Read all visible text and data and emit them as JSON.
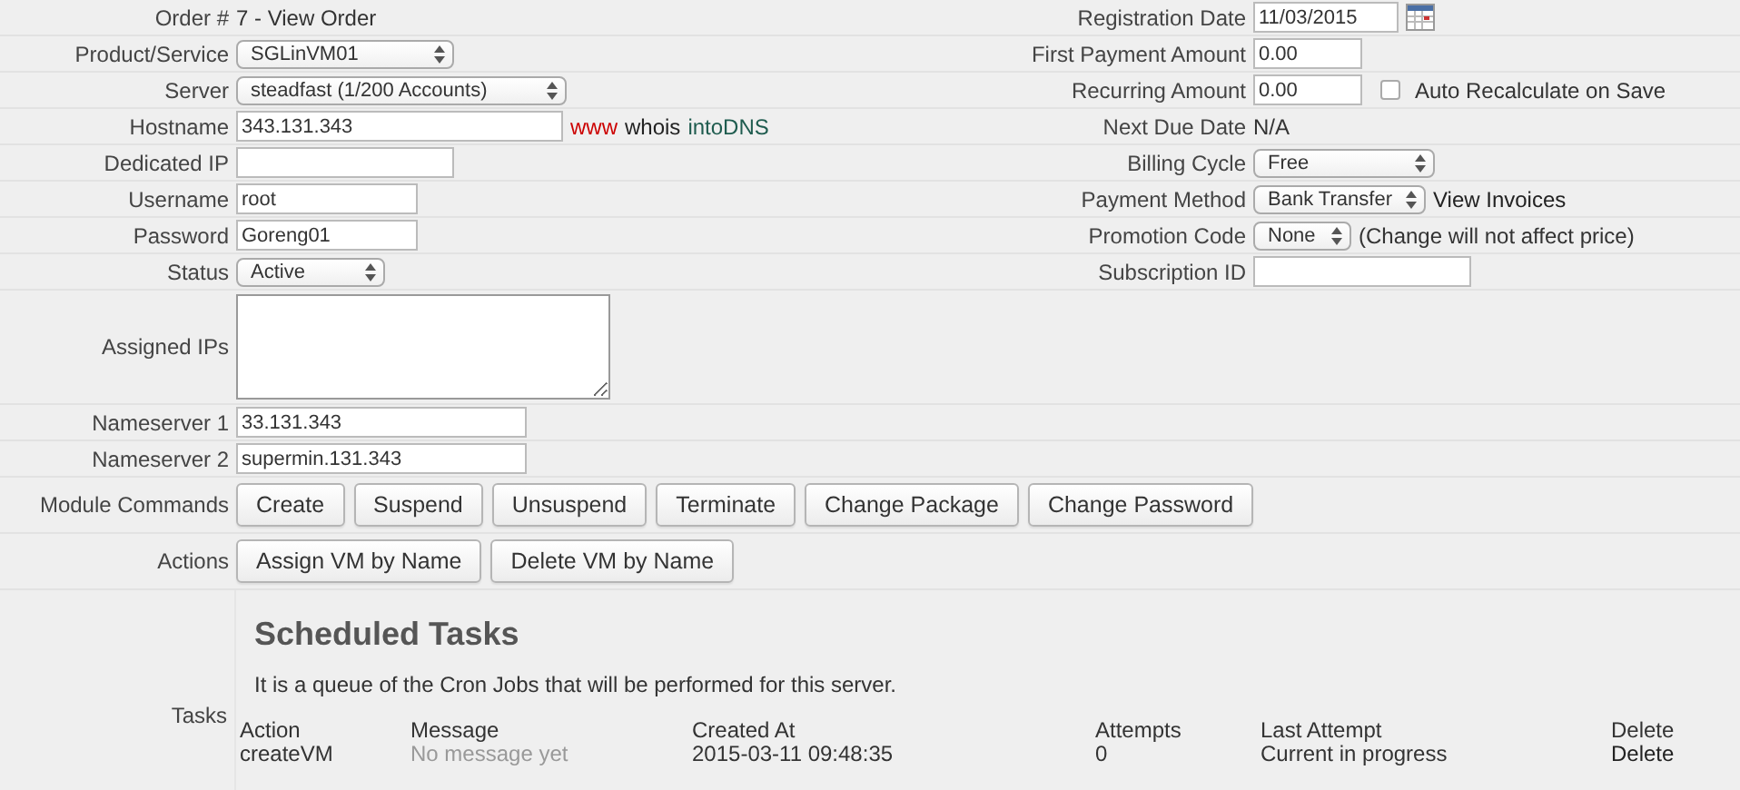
{
  "left_fields": [
    {
      "label": "Order #",
      "kind": "text",
      "value": "7 - View Order"
    },
    {
      "label": "Product/Service",
      "kind": "select",
      "value": "SGLinVM01"
    },
    {
      "label": "Server",
      "kind": "select",
      "value": "steadfast (1/200 Accounts)"
    },
    {
      "label": "Hostname",
      "kind": "input",
      "value": "343.131.343",
      "links": [
        {
          "text": "www",
          "color": "#cc0000"
        },
        {
          "text": "whois",
          "color": "#222222"
        },
        {
          "text": "intoDNS",
          "color": "#1f5c4f"
        }
      ]
    },
    {
      "label": "Dedicated IP",
      "kind": "input"
    },
    {
      "label": "Username",
      "kind": "input",
      "value": "root"
    },
    {
      "label": "Password",
      "kind": "input",
      "value": "Goreng01"
    },
    {
      "label": "Status",
      "kind": "select",
      "value": "Active"
    }
  ],
  "right_fields": [
    {
      "label": "Registration Date",
      "kind": "date",
      "value": "11/03/2015"
    },
    {
      "label": "First Payment Amount",
      "kind": "input",
      "value": "0.00"
    },
    {
      "label": "Recurring Amount",
      "kind": "input",
      "value": "0.00",
      "checkbox": {
        "label": "Auto Recalculate on Save",
        "checked": false
      }
    },
    {
      "label": "Next Due Date",
      "kind": "text",
      "value": "N/A"
    },
    {
      "label": "Billing Cycle",
      "kind": "select",
      "value": "Free"
    },
    {
      "label": "Payment Method",
      "kind": "select",
      "value": "Bank Transfer",
      "link": "View Invoices"
    },
    {
      "label": "Promotion Code",
      "kind": "select",
      "value": "None",
      "note": "(Change will not affect price)"
    },
    {
      "label": "Subscription ID",
      "kind": "input"
    }
  ],
  "assigned_ips": {
    "label": "Assigned IPs"
  },
  "nameservers": [
    {
      "label": "Nameserver 1",
      "value": "33.131.343"
    },
    {
      "label": "Nameserver 2",
      "value": "supermin.131.343"
    }
  ],
  "module_commands": {
    "label": "Module Commands",
    "buttons": [
      "Create",
      "Suspend",
      "Unsuspend",
      "Terminate",
      "Change Package",
      "Change Password"
    ]
  },
  "actions": {
    "label": "Actions",
    "buttons": [
      "Assign VM by Name",
      "Delete VM by Name"
    ]
  },
  "tasks": {
    "label": "Tasks",
    "title": "Scheduled Tasks",
    "description": "It is a queue of the Cron Jobs that will be performed for this server.",
    "columns": [
      "Action",
      "Message",
      "Created At",
      "Attempts",
      "Last Attempt",
      "Delete"
    ],
    "rows": [
      [
        "createVM",
        "No message yet",
        "2015-03-11 09:48:35",
        "0",
        "Current in progress",
        "Delete"
      ]
    ]
  }
}
